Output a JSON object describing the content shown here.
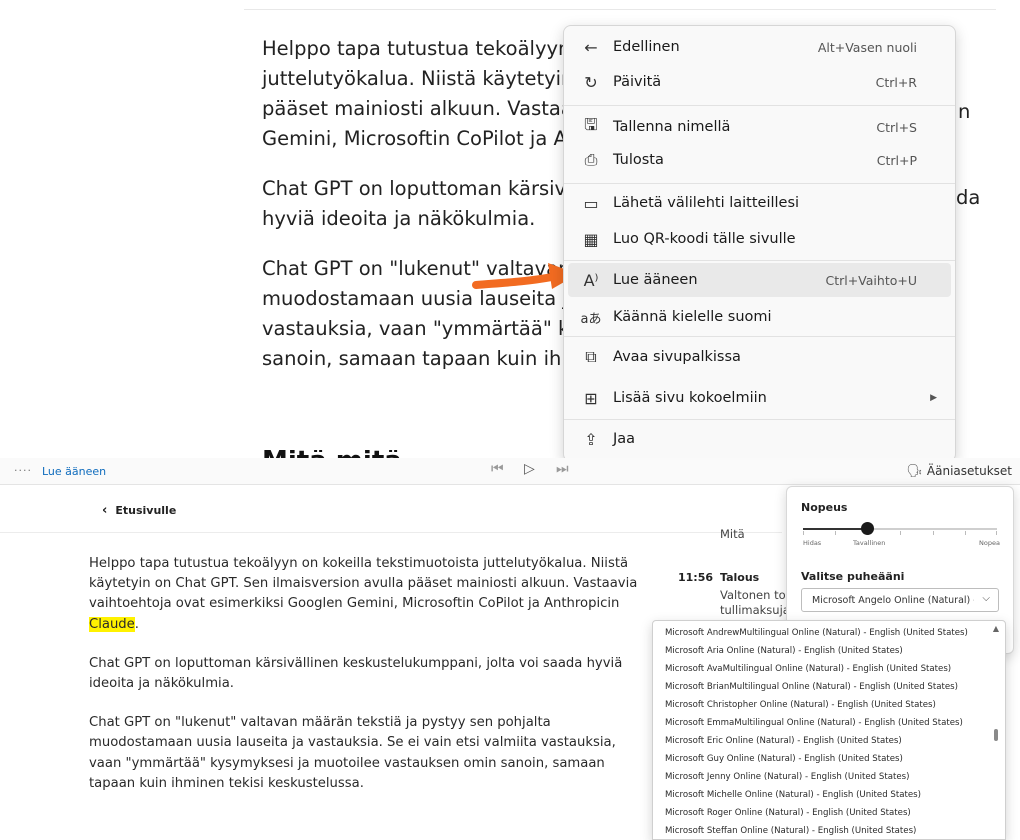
{
  "top_article": {
    "p1_lines": [
      "Helppo tapa tutustua tekoälyyn",
      "juttelutyökalua. Niistä käytetyin",
      "pääset mainiosti alkuun. Vastaa",
      "Gemini, Microsoftin CoPilot ja A"
    ],
    "p1_right_tail": "n",
    "p2_lines": [
      "Chat GPT on loputtoman kärsivä",
      "hyviä ideoita ja näkökulmia."
    ],
    "p2_right_tail": "da",
    "p3_lines": [
      "Chat GPT on \"lukenut\" valtavan",
      "muodostamaan uusia lauseita ja",
      "vastauksia, vaan \"ymmärtää\" ky",
      "sanoin, samaan tapaan kuin ihm"
    ],
    "heading_fragment": "Mitä mitä tekoäly"
  },
  "context_menu": {
    "items": [
      {
        "icon": "back-arrow-icon",
        "glyph": "←",
        "label": "Edellinen",
        "shortcut": "Alt+Vasen nuoli"
      },
      {
        "icon": "refresh-icon",
        "glyph": "↻",
        "label": "Päivitä",
        "shortcut": "Ctrl+R"
      },
      {
        "icon": "save-as-icon",
        "glyph": "🖫",
        "label": "Tallenna nimellä",
        "shortcut": "Ctrl+S"
      },
      {
        "icon": "printer-icon",
        "glyph": "⎙",
        "label": "Tulosta",
        "shortcut": "Ctrl+P"
      },
      {
        "icon": "send-to-devices-icon",
        "glyph": "▭",
        "label": "Lähetä välilehti laitteillesi",
        "shortcut": ""
      },
      {
        "icon": "qr-code-icon",
        "glyph": "▦",
        "label": "Luo QR-koodi tälle sivulle",
        "shortcut": ""
      },
      {
        "icon": "read-aloud-icon",
        "glyph": "A⁾",
        "label": "Lue ääneen",
        "shortcut": "Ctrl+Vaihto+U"
      },
      {
        "icon": "translate-icon",
        "glyph": "aあ",
        "label": "Käännä kielelle suomi",
        "shortcut": ""
      },
      {
        "icon": "sidebar-icon",
        "glyph": "⧉",
        "label": "Avaa sivupalkissa",
        "shortcut": ""
      },
      {
        "icon": "collections-icon",
        "glyph": "⊞",
        "label": "Lisää sivu kokoelmiin",
        "shortcut": ""
      },
      {
        "icon": "share-icon",
        "glyph": "⇪",
        "label": "Jaa",
        "shortcut": ""
      }
    ]
  },
  "toolbar": {
    "title": "Lue ääneen",
    "voice_settings_label": "Ääniasetukset"
  },
  "reader": {
    "back_label": "Etusivulle",
    "p1_before": "Helppo tapa tutustua tekoälyyn on kokeilla tekstimuotoista juttelutyökalua. Niistä käytetyin on Chat GPT. Sen ilmaisversion avulla pääset mainiosti alkuun. Vastaavia vaihtoehtoja ovat esimerkiksi Googlen Gemini, Microsoftin CoPilot ja Anthropicin ",
    "p1_highlight": "Claude",
    "p1_after": ".",
    "p2": "Chat GPT on loputtoman kärsivällinen keskustelukumppani, jolta voi saada hyviä ideoita ja näkökulmia.",
    "p3": "Chat GPT on \"lukenut\" valtavan määrän tekstiä ja pystyy sen pohjalta muodostamaan uusia lauseita ja vastauksia. Se ei vain etsi valmiita vastauksia, vaan \"ymmärtää\" kysymyksesi ja muotoilee vastauksen omin sanoin, samaan tapaan kuin ihminen tekisi keskustelussa.",
    "news_top": "Mitä keväan",
    "news_time": "11:56",
    "news_category": "Talous",
    "news_line1": "Valtonen toi",
    "news_line2": "tullimaksuja"
  },
  "voice_panel": {
    "speed_title": "Nopeus",
    "speed_value": 0.33,
    "speed_labels": [
      "Hidas",
      "Tavallinen",
      "Nopea"
    ],
    "voice_title": "Valitse puheääni",
    "selected_voice": "Microsoft Angelo Online (Natural) - F"
  },
  "voice_list": [
    "Microsoft AndrewMultilingual Online (Natural) - English (United States)",
    "Microsoft Aria Online (Natural) - English (United States)",
    "Microsoft AvaMultilingual Online (Natural) - English (United States)",
    "Microsoft BrianMultilingual Online (Natural) - English (United States)",
    "Microsoft Christopher Online (Natural) - English (United States)",
    "Microsoft EmmaMultilingual Online (Natural) - English (United States)",
    "Microsoft Eric Online (Natural) - English (United States)",
    "Microsoft Guy Online (Natural) - English (United States)",
    "Microsoft Jenny Online (Natural) - English (United States)",
    "Microsoft Michelle Online (Natural) - English (United States)",
    "Microsoft Roger Online (Natural) - English (United States)",
    "Microsoft Steffan Online (Natural) - English (United States)"
  ],
  "colors": {
    "accent": "#0f6cbd",
    "highlight": "#fff200",
    "arrow": "#f26b21",
    "menu_hover": "#e9e9e9"
  }
}
